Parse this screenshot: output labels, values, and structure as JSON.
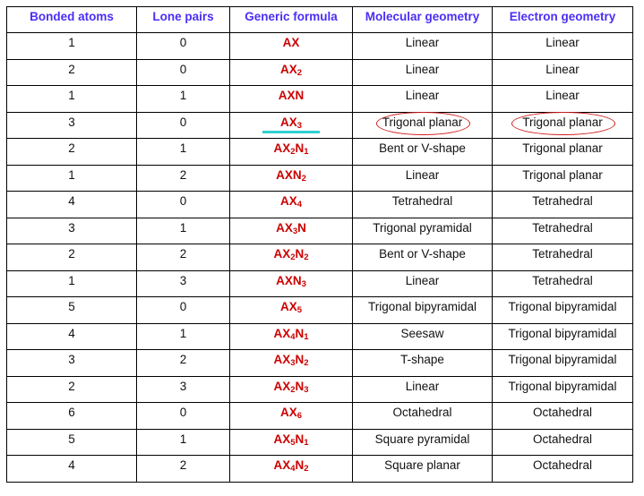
{
  "table": {
    "headers": [
      "Bonded atoms",
      "Lone pairs",
      "Generic formula",
      "Molecular geometry",
      "Electron geometry"
    ],
    "header_color": "#4a2ef5",
    "formula_color": "#cc0000",
    "annotation_color": "#d01c1c",
    "highlight_color": "#2fd0d0",
    "rows": [
      {
        "bonded": "1",
        "lone": "0",
        "formula": {
          "A": "A",
          "X": "X",
          "xn": "",
          "N": "",
          "nn": ""
        },
        "molecular": "Linear",
        "electron": "Linear"
      },
      {
        "bonded": "2",
        "lone": "0",
        "formula": {
          "A": "A",
          "X": "X",
          "xn": "2",
          "N": "",
          "nn": ""
        },
        "molecular": "Linear",
        "electron": "Linear"
      },
      {
        "bonded": "1",
        "lone": "1",
        "formula": {
          "A": "A",
          "X": "X",
          "xn": "",
          "N": "N",
          "nn": ""
        },
        "molecular": "Linear",
        "electron": "Linear"
      },
      {
        "bonded": "3",
        "lone": "0",
        "formula": {
          "A": "A",
          "X": "X",
          "xn": "3",
          "N": "",
          "nn": ""
        },
        "molecular": "Trigonal planar",
        "electron": "Trigonal planar",
        "highlighted": true
      },
      {
        "bonded": "2",
        "lone": "1",
        "formula": {
          "A": "A",
          "X": "X",
          "xn": "2",
          "N": "N",
          "nn": "1"
        },
        "molecular": "Bent or V-shape",
        "electron": "Trigonal planar"
      },
      {
        "bonded": "1",
        "lone": "2",
        "formula": {
          "A": "A",
          "X": "X",
          "xn": "",
          "N": "N",
          "nn": "2"
        },
        "molecular": "Linear",
        "electron": "Trigonal planar"
      },
      {
        "bonded": "4",
        "lone": "0",
        "formula": {
          "A": "A",
          "X": "X",
          "xn": "4",
          "N": "",
          "nn": ""
        },
        "molecular": "Tetrahedral",
        "electron": "Tetrahedral"
      },
      {
        "bonded": "3",
        "lone": "1",
        "formula": {
          "A": "A",
          "X": "X",
          "xn": "3",
          "N": "N",
          "nn": ""
        },
        "molecular": "Trigonal pyramidal",
        "electron": "Tetrahedral"
      },
      {
        "bonded": "2",
        "lone": "2",
        "formula": {
          "A": "A",
          "X": "X",
          "xn": "2",
          "N": "N",
          "nn": "2"
        },
        "molecular": "Bent or V-shape",
        "electron": "Tetrahedral"
      },
      {
        "bonded": "1",
        "lone": "3",
        "formula": {
          "A": "A",
          "X": "X",
          "xn": "",
          "N": "N",
          "nn": "3"
        },
        "molecular": "Linear",
        "electron": "Tetrahedral"
      },
      {
        "bonded": "5",
        "lone": "0",
        "formula": {
          "A": "A",
          "X": "X",
          "xn": "5",
          "N": "",
          "nn": ""
        },
        "molecular": "Trigonal bipyramidal",
        "electron": "Trigonal bipyramidal"
      },
      {
        "bonded": "4",
        "lone": "1",
        "formula": {
          "A": "A",
          "X": "X",
          "xn": "4",
          "N": "N",
          "nn": "1"
        },
        "molecular": "Seesaw",
        "electron": "Trigonal bipyramidal"
      },
      {
        "bonded": "3",
        "lone": "2",
        "formula": {
          "A": "A",
          "X": "X",
          "xn": "3",
          "N": "N",
          "nn": "2"
        },
        "molecular": "T-shape",
        "electron": "Trigonal bipyramidal"
      },
      {
        "bonded": "2",
        "lone": "3",
        "formula": {
          "A": "A",
          "X": "X",
          "xn": "2",
          "N": "N",
          "nn": "3"
        },
        "molecular": "Linear",
        "electron": "Trigonal bipyramidal"
      },
      {
        "bonded": "6",
        "lone": "0",
        "formula": {
          "A": "A",
          "X": "X",
          "xn": "6",
          "N": "",
          "nn": ""
        },
        "molecular": "Octahedral",
        "electron": "Octahedral"
      },
      {
        "bonded": "5",
        "lone": "1",
        "formula": {
          "A": "A",
          "X": "X",
          "xn": "5",
          "N": "N",
          "nn": "1"
        },
        "molecular": "Square pyramidal",
        "electron": "Octahedral"
      },
      {
        "bonded": "4",
        "lone": "2",
        "formula": {
          "A": "A",
          "X": "X",
          "xn": "4",
          "N": "N",
          "nn": "2"
        },
        "molecular": "Square planar",
        "electron": "Octahedral"
      }
    ]
  }
}
